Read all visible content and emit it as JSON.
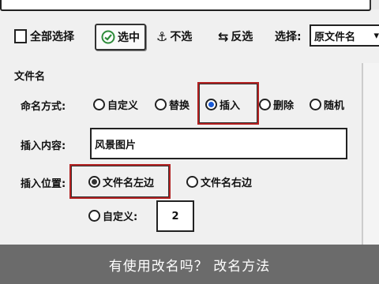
{
  "toolbar": {
    "select_all_label": "全部选择",
    "select_label": "选中",
    "unselect_label": "不选",
    "invert_label": "反选",
    "filter_label": "选择:",
    "filter_value": "原文件名"
  },
  "section": {
    "filename_title": "文件名"
  },
  "naming_mode": {
    "label": "命名方式:",
    "options": [
      "自定义",
      "替换",
      "插入",
      "删除",
      "随机"
    ],
    "selected": "插入"
  },
  "insert_content": {
    "label": "插入内容:",
    "value": "风景图片"
  },
  "insert_position": {
    "label": "插入位置:",
    "options": [
      "文件名左边",
      "文件名右边"
    ],
    "selected": "文件名左边",
    "custom_label": "自定义:",
    "custom_value": "2"
  },
  "footer": {
    "caption": "有使用改名吗？  改名方法"
  },
  "colors": {
    "highlight": "#b32020",
    "radio_selected": "#1a5ad6",
    "footer_bg": "#6b6b6b"
  }
}
